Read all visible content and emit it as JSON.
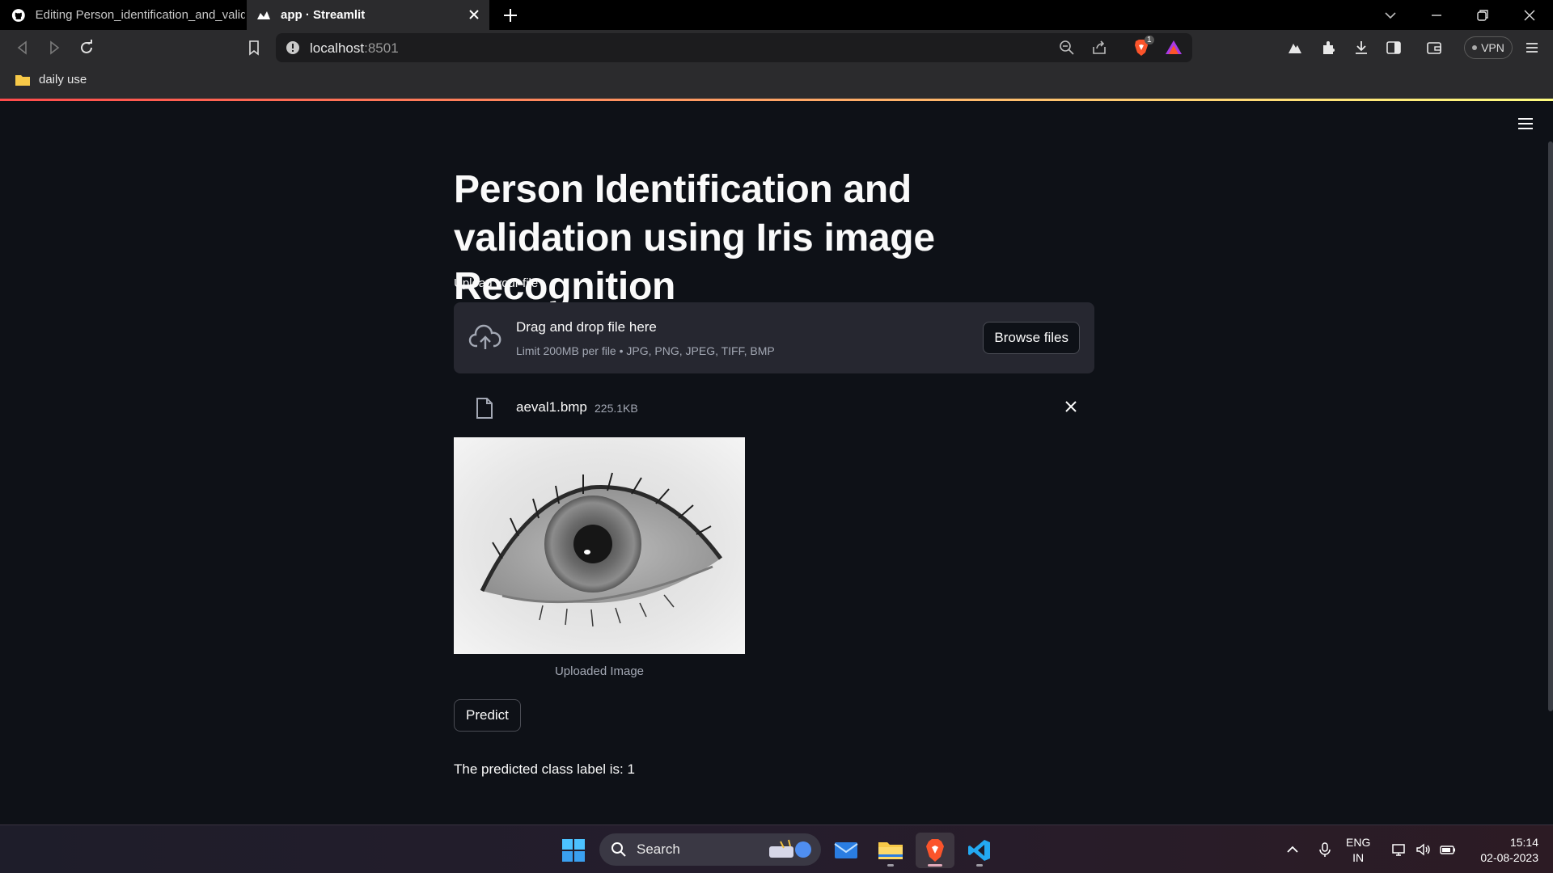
{
  "browser": {
    "tabs": [
      {
        "title": "Editing Person_identification_and_validation",
        "active": false,
        "icon": "github-icon"
      },
      {
        "title": "app · Streamlit",
        "active": true,
        "icon": "streamlit-icon"
      }
    ],
    "url_host": "localhost",
    "url_port": ":8501",
    "vpn_label": "VPN",
    "brave_badge": "1",
    "bookmarks": [
      {
        "label": "daily use",
        "icon": "folder-icon"
      }
    ]
  },
  "app": {
    "title": "Person Identification and validation using Iris image Recognition",
    "uploader": {
      "label": "Upload your file",
      "drop_text": "Drag and drop file here",
      "limit_text": "Limit 200MB per file • JPG, PNG, JPEG, TIFF, BMP",
      "browse_label": "Browse files"
    },
    "uploaded_file": {
      "name": "aeval1.bmp",
      "size": "225.1KB"
    },
    "image_caption": "Uploaded Image",
    "predict_label": "Predict",
    "result_text": "The predicted class label is: 1"
  },
  "taskbar": {
    "search_label": "Search",
    "lang_line1": "ENG",
    "lang_line2": "IN",
    "time": "15:14",
    "date": "02-08-2023"
  },
  "colors": {
    "app_bg": "#0e1117",
    "panel_bg": "#262730",
    "accent_gradient_start": "#ff4b4b",
    "accent_gradient_end": "#fffd80"
  }
}
